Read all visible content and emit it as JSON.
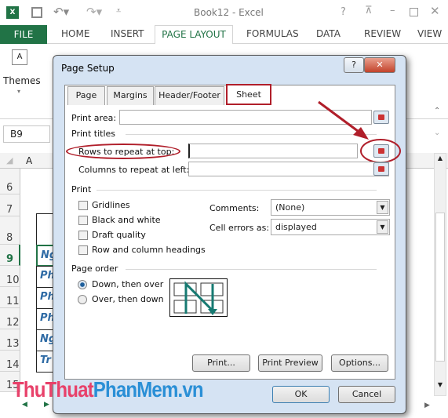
{
  "window": {
    "title": "Book12 - Excel",
    "help": "?"
  },
  "ribbon": {
    "tabs": [
      "FILE",
      "HOME",
      "INSERT",
      "PAGE LAYOUT",
      "FORMULAS",
      "DATA",
      "REVIEW",
      "VIEW"
    ],
    "active": "PAGE LAYOUT",
    "themes_label": "Themes"
  },
  "sheet": {
    "name_box": "B9",
    "column_a": "A",
    "rows": [
      "6",
      "7",
      "8",
      "9",
      "10",
      "11",
      "12",
      "13",
      "14",
      "15"
    ],
    "cells": [
      "Ng",
      "Ph",
      "Ph",
      "Ph",
      "Ng",
      "Tr"
    ]
  },
  "dialog": {
    "title": "Page Setup",
    "tabs": [
      "Page",
      "Margins",
      "Header/Footer",
      "Sheet"
    ],
    "active_tab": "Sheet",
    "print_area_label": "Print area:",
    "print_area_value": "",
    "print_titles_label": "Print titles",
    "rows_repeat_label": "Rows to repeat at top:",
    "rows_repeat_value": "",
    "cols_repeat_label": "Columns to repeat at left:",
    "cols_repeat_value": "",
    "print_label": "Print",
    "checkboxes": [
      {
        "label": "Gridlines",
        "checked": false
      },
      {
        "label": "Black and white",
        "checked": false
      },
      {
        "label": "Draft quality",
        "checked": false
      },
      {
        "label": "Row and column headings",
        "checked": false
      }
    ],
    "comments_label": "Comments:",
    "comments_value": "(None)",
    "cell_errors_label": "Cell errors as:",
    "cell_errors_value": "displayed",
    "page_order_label": "Page order",
    "radios": [
      {
        "label": "Down, then over",
        "selected": true
      },
      {
        "label": "Over, then down",
        "selected": false
      }
    ],
    "buttons": {
      "print": "Print...",
      "print_preview": "Print Preview",
      "options": "Options...",
      "ok": "OK",
      "cancel": "Cancel"
    }
  },
  "watermark": {
    "part1": "ThuThuat",
    "part2": "PhanMem.vn",
    "color1": "#e8416a",
    "color2": "#2a8fd6"
  },
  "annotation_color": "#b01e2a",
  "accent": "#217346"
}
